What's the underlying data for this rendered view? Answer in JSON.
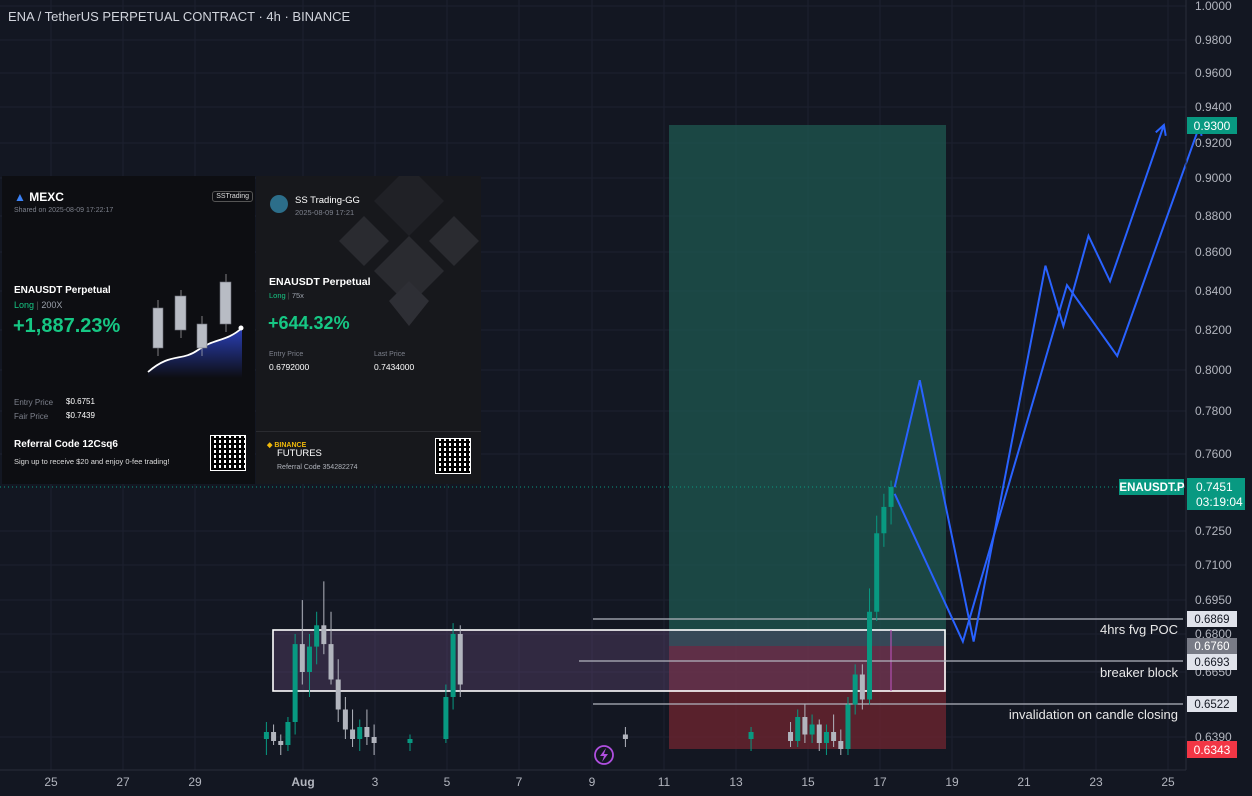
{
  "chart_title": "ENA / TetherUS PERPETUAL CONTRACT · 4h · BINANCE",
  "colors": {
    "bg": "#131722",
    "up": "#089981",
    "down": "#b2b5be",
    "tp_zone": "#1e5a52",
    "sl_zone": "#6b2430",
    "fvg_box": "#6b4a7a",
    "arrow": "#2962ff",
    "lastprice": "#089981",
    "sl_tag": "#f23645"
  },
  "price_axis": {
    "ticks": [
      "1.0000",
      "0.9800",
      "0.9600",
      "0.9400",
      "0.9200",
      "0.9000",
      "0.8800",
      "0.8600",
      "0.8400",
      "0.8200",
      "0.8000",
      "0.7800",
      "0.7600",
      "0.7250",
      "0.7100",
      "0.6950",
      "0.6800",
      "0.6650",
      "0.6390"
    ],
    "tp_tag": "0.9300",
    "sl_tag": "0.6343",
    "current_price": "0.7451",
    "countdown": "03:19:04",
    "symbol_tag": "ENAUSDT.P",
    "level_tags": [
      "0.6869",
      "0.6760",
      "0.6693",
      "0.6522"
    ]
  },
  "time_axis": [
    "25",
    "27",
    "29",
    "Aug",
    "3",
    "5",
    "7",
    "9",
    "11",
    "13",
    "15",
    "17",
    "19",
    "21",
    "23",
    "25"
  ],
  "annotations": {
    "poc": "4hrs fvg POC",
    "breaker": "breaker block",
    "invalidation": "invalidation on candle closing"
  },
  "mexc_card": {
    "brand": "MEXC",
    "badge": "SSTrading",
    "shared": "Shared on 2025-08-09 17:22:17",
    "pair": "ENAUSDT Perpetual",
    "side": "Long",
    "leverage": "200X",
    "roi": "+1,887.23%",
    "entry_label": "Entry Price",
    "entry_value": "$0.6751",
    "fair_label": "Fair Price",
    "fair_value": "$0.7439",
    "referral": "Referral Code 12Csq6",
    "promo": "Sign up to receive $20 and enjoy 0-fee trading!"
  },
  "binance_card": {
    "user": "SS Trading-GG",
    "date": "2025-08-09 17:21",
    "pair": "ENAUSDT Perpetual",
    "side": "Long",
    "leverage": "75x",
    "roi": "+644.32%",
    "entry_label": "Entry Price",
    "entry_value": "0.6792000",
    "last_label": "Last Price",
    "last_value": "0.7434000",
    "brand": "BINANCE",
    "product": "FUTURES",
    "referral": "Referral Code 354282274"
  },
  "chart_data": {
    "type": "candlestick",
    "title": "ENA / TetherUS PERPETUAL CONTRACT · 4h · BINANCE",
    "y_range": [
      0.63,
      1.0
    ],
    "x_labels": [
      "25",
      "27",
      "29",
      "Aug",
      "3",
      "5",
      "7",
      "9",
      "11",
      "13",
      "15",
      "17",
      "19",
      "21",
      "23",
      "25"
    ],
    "last_price": 0.7451,
    "take_profit": 0.93,
    "stop_loss": 0.6343,
    "levels": [
      {
        "price": 0.6869,
        "label": "4hrs fvg POC"
      },
      {
        "price": 0.676,
        "label": ""
      },
      {
        "price": 0.6693,
        "label": "breaker block"
      },
      {
        "price": 0.6522,
        "label": "invalidation on candle closing"
      }
    ],
    "candles": [
      {
        "d": 6.0,
        "o": 0.638,
        "h": 0.645,
        "l": 0.63,
        "c": 0.641
      },
      {
        "d": 6.2,
        "o": 0.641,
        "h": 0.644,
        "l": 0.635,
        "c": 0.637
      },
      {
        "d": 6.4,
        "o": 0.637,
        "h": 0.64,
        "l": 0.63,
        "c": 0.635
      },
      {
        "d": 6.6,
        "o": 0.635,
        "h": 0.647,
        "l": 0.632,
        "c": 0.645
      },
      {
        "d": 6.8,
        "o": 0.645,
        "h": 0.68,
        "l": 0.64,
        "c": 0.676
      },
      {
        "d": 7.0,
        "o": 0.676,
        "h": 0.695,
        "l": 0.66,
        "c": 0.665
      },
      {
        "d": 7.2,
        "o": 0.665,
        "h": 0.68,
        "l": 0.655,
        "c": 0.675
      },
      {
        "d": 7.4,
        "o": 0.675,
        "h": 0.69,
        "l": 0.668,
        "c": 0.684
      },
      {
        "d": 7.6,
        "o": 0.684,
        "h": 0.703,
        "l": 0.672,
        "c": 0.676
      },
      {
        "d": 7.8,
        "o": 0.676,
        "h": 0.69,
        "l": 0.66,
        "c": 0.662
      },
      {
        "d": 8.0,
        "o": 0.662,
        "h": 0.67,
        "l": 0.645,
        "c": 0.65
      },
      {
        "d": 8.2,
        "o": 0.65,
        "h": 0.655,
        "l": 0.638,
        "c": 0.642
      },
      {
        "d": 8.4,
        "o": 0.642,
        "h": 0.65,
        "l": 0.634,
        "c": 0.638
      },
      {
        "d": 8.6,
        "o": 0.638,
        "h": 0.646,
        "l": 0.632,
        "c": 0.643
      },
      {
        "d": 8.8,
        "o": 0.643,
        "h": 0.65,
        "l": 0.635,
        "c": 0.639
      },
      {
        "d": 9.0,
        "o": 0.639,
        "h": 0.644,
        "l": 0.63,
        "c": 0.636
      },
      {
        "d": 10.0,
        "o": 0.636,
        "h": 0.64,
        "l": 0.632,
        "c": 0.638
      },
      {
        "d": 11.0,
        "o": 0.638,
        "h": 0.66,
        "l": 0.636,
        "c": 0.655
      },
      {
        "d": 11.2,
        "o": 0.655,
        "h": 0.685,
        "l": 0.65,
        "c": 0.68
      },
      {
        "d": 11.4,
        "o": 0.68,
        "h": 0.684,
        "l": 0.655,
        "c": 0.66
      },
      {
        "d": 16.0,
        "o": 0.64,
        "h": 0.643,
        "l": 0.634,
        "c": 0.638
      },
      {
        "d": 19.5,
        "o": 0.638,
        "h": 0.643,
        "l": 0.632,
        "c": 0.641
      },
      {
        "d": 20.6,
        "o": 0.641,
        "h": 0.645,
        "l": 0.634,
        "c": 0.637
      },
      {
        "d": 20.8,
        "o": 0.637,
        "h": 0.65,
        "l": 0.634,
        "c": 0.647
      },
      {
        "d": 21.0,
        "o": 0.647,
        "h": 0.652,
        "l": 0.636,
        "c": 0.64
      },
      {
        "d": 21.2,
        "o": 0.64,
        "h": 0.648,
        "l": 0.636,
        "c": 0.644
      },
      {
        "d": 21.4,
        "o": 0.644,
        "h": 0.646,
        "l": 0.632,
        "c": 0.636
      },
      {
        "d": 21.6,
        "o": 0.636,
        "h": 0.644,
        "l": 0.63,
        "c": 0.641
      },
      {
        "d": 21.8,
        "o": 0.641,
        "h": 0.648,
        "l": 0.634,
        "c": 0.637
      },
      {
        "d": 22.0,
        "o": 0.637,
        "h": 0.642,
        "l": 0.63,
        "c": 0.633
      },
      {
        "d": 22.2,
        "o": 0.633,
        "h": 0.655,
        "l": 0.63,
        "c": 0.652
      },
      {
        "d": 22.4,
        "o": 0.652,
        "h": 0.668,
        "l": 0.648,
        "c": 0.664
      },
      {
        "d": 22.6,
        "o": 0.664,
        "h": 0.668,
        "l": 0.65,
        "c": 0.654
      },
      {
        "d": 22.8,
        "o": 0.654,
        "h": 0.7,
        "l": 0.652,
        "c": 0.69
      },
      {
        "d": 23.0,
        "o": 0.69,
        "h": 0.732,
        "l": 0.686,
        "c": 0.724
      },
      {
        "d": 23.2,
        "o": 0.724,
        "h": 0.742,
        "l": 0.718,
        "c": 0.736
      },
      {
        "d": 23.4,
        "o": 0.736,
        "h": 0.748,
        "l": 0.728,
        "c": 0.7451
      }
    ],
    "projection_path_1": [
      [
        23.5,
        0.745
      ],
      [
        24.2,
        0.795
      ],
      [
        25.7,
        0.677
      ],
      [
        27.7,
        0.853
      ],
      [
        28.2,
        0.822
      ],
      [
        28.9,
        0.869
      ],
      [
        29.5,
        0.845
      ],
      [
        31.0,
        0.93
      ]
    ],
    "projection_path_2": [
      [
        23.5,
        0.742
      ],
      [
        25.4,
        0.677
      ],
      [
        28.3,
        0.843
      ],
      [
        29.7,
        0.807
      ],
      [
        32.0,
        0.93
      ]
    ]
  }
}
